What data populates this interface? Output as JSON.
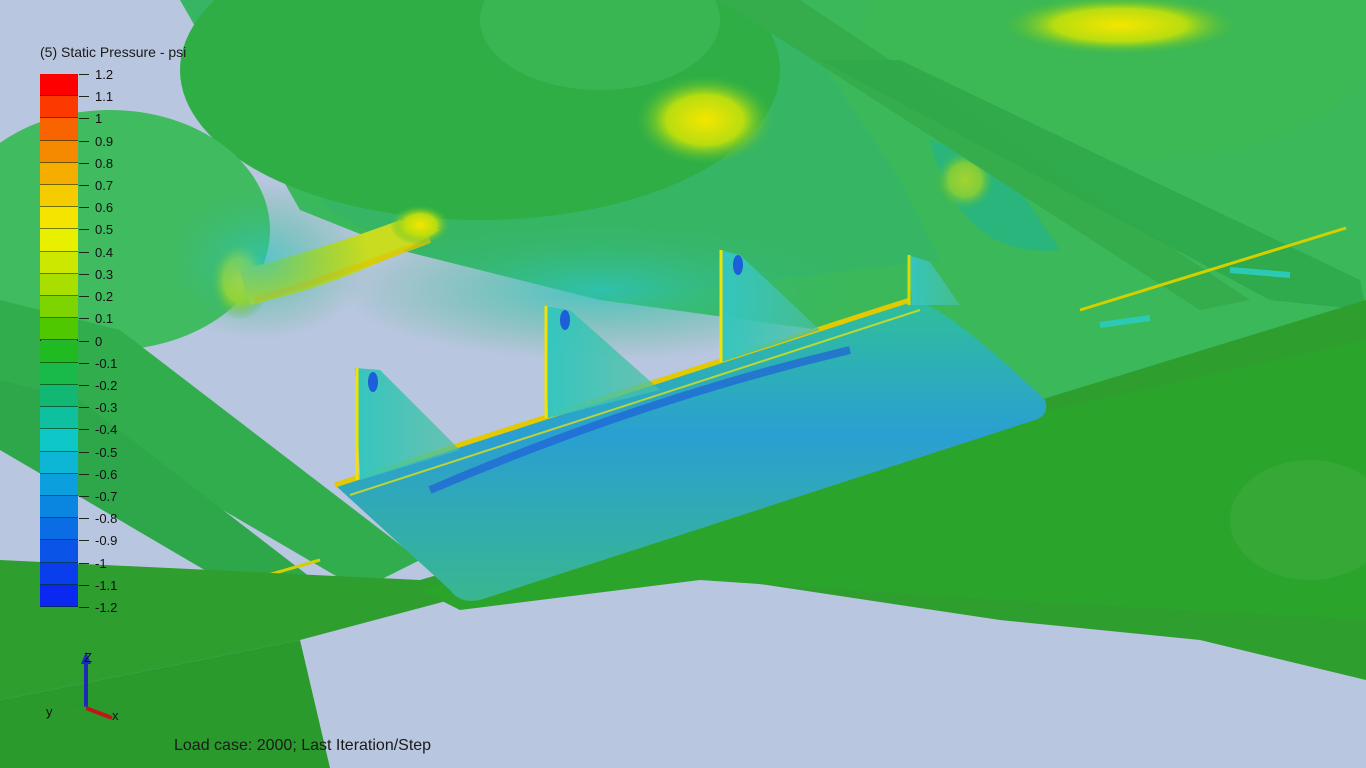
{
  "legend": {
    "title": "(5) Static Pressure - psi",
    "ticks": [
      "1.2",
      "1.1",
      "1",
      "0.9",
      "0.8",
      "0.7",
      "0.6",
      "0.5",
      "0.4",
      "0.3",
      "0.2",
      "0.1",
      "0",
      "-0.1",
      "-0.2",
      "-0.3",
      "-0.4",
      "-0.5",
      "-0.6",
      "-0.7",
      "-0.8",
      "-0.9",
      "-1",
      "-1.1",
      "-1.2"
    ],
    "colors": [
      "#ff0000",
      "#fc3a00",
      "#f86400",
      "#f58a00",
      "#f5ad00",
      "#f5cc00",
      "#f5e400",
      "#e8f000",
      "#cde800",
      "#a8df00",
      "#7ed400",
      "#50c800",
      "#1fbb20",
      "#19ba4a",
      "#12b774",
      "#0fc0a0",
      "#0ec8c8",
      "#0eb6d6",
      "#0c9fdd",
      "#0b86e0",
      "#0a6de4",
      "#0a55e8",
      "#0a3eec",
      "#0a28f0"
    ]
  },
  "status": {
    "load_case": "Load case: 2000; Last Iteration/Step"
  },
  "triad": {
    "z_label": "Z",
    "y_label": "y",
    "x_label": "x"
  }
}
